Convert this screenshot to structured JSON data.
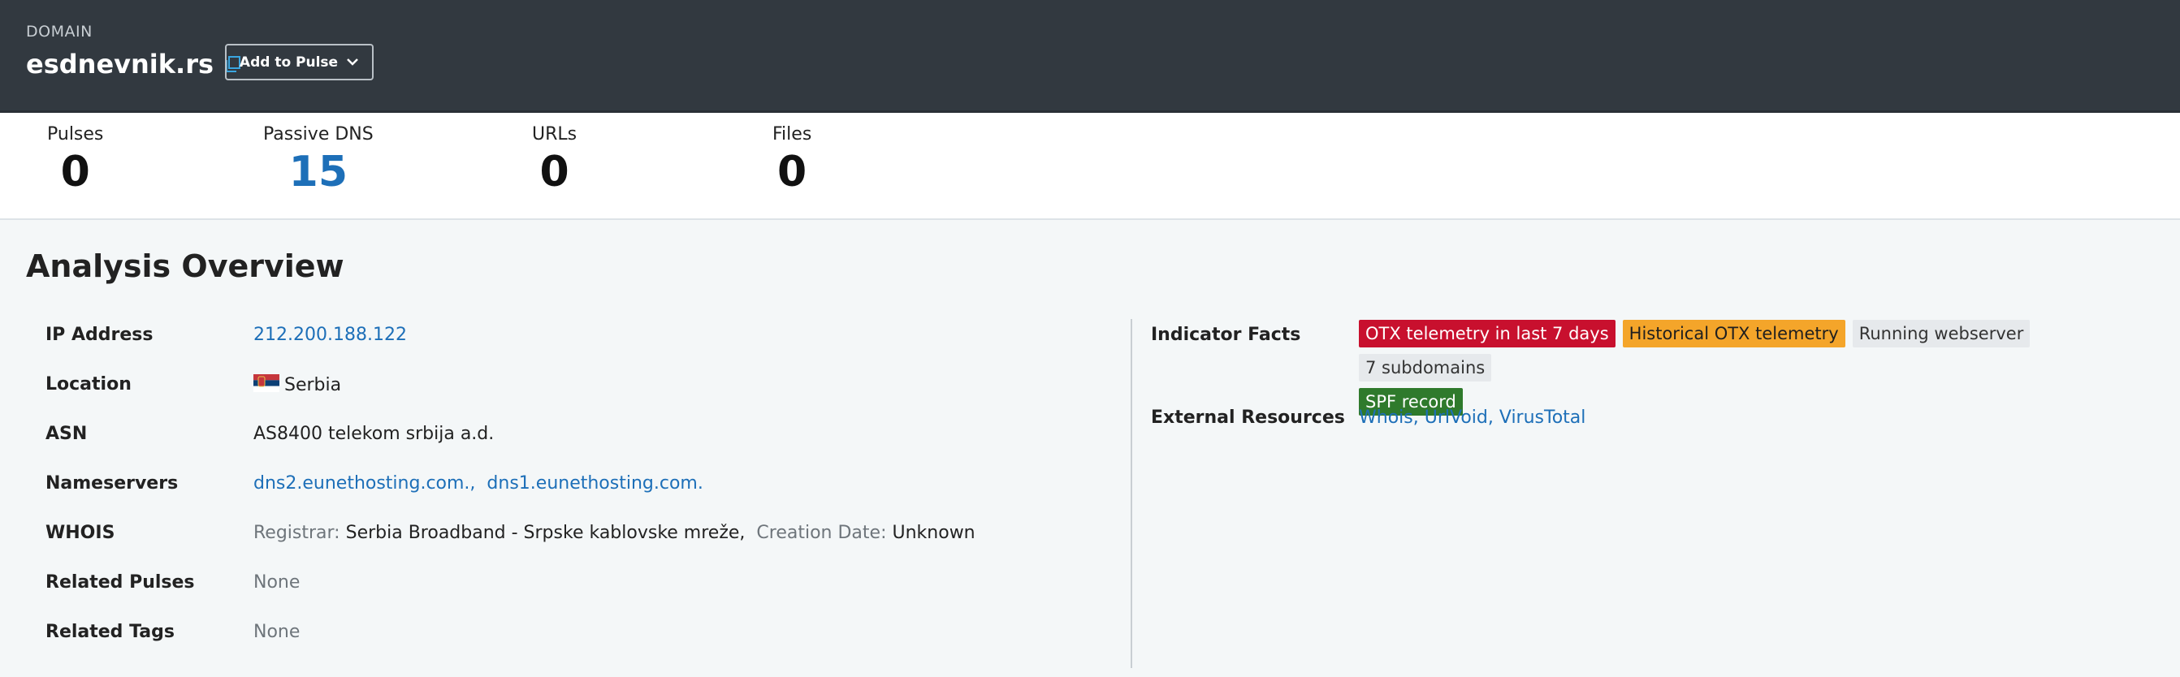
{
  "header": {
    "type_label": "DOMAIN",
    "domain": "esdnevnik.rs",
    "copy_icon": "copy-icon",
    "add_button_label": "Add to Pulse",
    "add_button_icon": "chevron-down-icon"
  },
  "stats": [
    {
      "label": "Pulses",
      "value": "0"
    },
    {
      "label": "Passive DNS",
      "value": "15"
    },
    {
      "label": "URLs",
      "value": "0"
    },
    {
      "label": "Files",
      "value": "0"
    }
  ],
  "overview": {
    "title": "Analysis Overview",
    "left": {
      "ip_address": {
        "label": "IP Address",
        "value": "212.200.188.122"
      },
      "location": {
        "label": "Location",
        "value": "Serbia",
        "flag": "serbia-flag-icon"
      },
      "asn": {
        "label": "ASN",
        "value": "AS8400 telekom srbija a.d."
      },
      "nameservers": {
        "label": "Nameservers",
        "values": [
          "dns2.eunethosting.com.,",
          "dns1.eunethosting.com."
        ]
      },
      "whois": {
        "label": "WHOIS",
        "registrar_key": "Registrar:",
        "registrar_value": "Serbia Broadband - Srpske kablovske mreže,",
        "creation_key": "Creation Date:",
        "creation_value": "Unknown"
      },
      "related_pulses": {
        "label": "Related Pulses",
        "value": "None"
      },
      "related_tags": {
        "label": "Related Tags",
        "value": "None"
      }
    },
    "right": {
      "indicator_facts": {
        "label": "Indicator Facts",
        "badges": [
          {
            "text": "OTX telemetry in last 7 days",
            "color": "#c8102e"
          },
          {
            "text": "Historical OTX telemetry",
            "color": "#f4a52a"
          },
          {
            "text": "Running webserver",
            "color": "#e6e9ec"
          },
          {
            "text": "7 subdomains",
            "color": "#e6e9ec"
          },
          {
            "text": "SPF record",
            "color": "#2f7a2c"
          }
        ]
      },
      "external_resources": {
        "label": "External Resources",
        "links": [
          "Whois,",
          "UrlVoid,",
          "VirusTotal"
        ]
      }
    }
  }
}
